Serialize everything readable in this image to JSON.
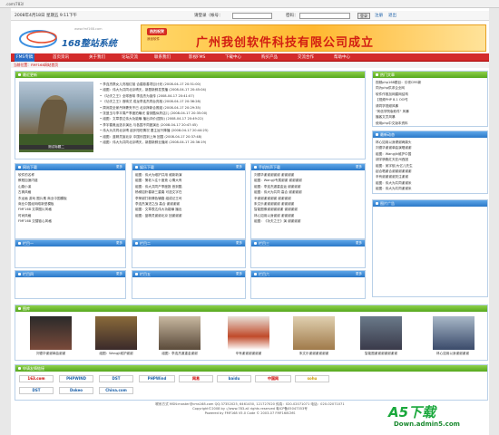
{
  "browser": {
    "url": ".com/783/"
  },
  "topbar": {
    "date": "2008年4月18日 星期五 9:11下午",
    "user_label": "请登录（帐号：",
    "pwd_label": "密码：",
    "login_btn": "登录",
    "register": "注册",
    "back": "退出"
  },
  "header": {
    "logo_text": "168整站系统",
    "logo_url": "www.fmf168.com",
    "banner_tag": "热烈祝贺",
    "banner_title": "广州我创软件科技有限公司成立",
    "banner_sub": "我创软件"
  },
  "nav": {
    "items": [
      "FMS专稿",
      "首页资讯",
      "关于我们",
      "论坛交流",
      "联系我们",
      "影视FMS",
      "下载中心",
      "购买产品",
      "交流合作",
      "帮助中心"
    ]
  },
  "breadcrumb": "当前位置：FMF168网站首页",
  "latest": {
    "title": "最近更新",
    "photo_caption": "测试标题二",
    "items": [
      "• 李连杰携女儿亮相红毯 合建慈善项目计划 (2008-04-17 20:51:00)",
      "• 组图：伟大为共同北京晴天，新剧新鲜发表播 (2008-04-17 20:45:04)",
      "• 《功夫之王》全球首映 李连杰为宣传 (2008-04-17 20:41:07)",
      "• 《功夫之王》首映式 成龙李连杰同台亮相 (2008-04-17 20:36:28)",
      "• 周润发全家丹拜妻夹不已 北京拜新合照组 (2008-04-17 20:29:35)",
      "• 张曼玉与李平周产季度拍曝光 曾到酷似药店儿 (2008-04-17 20:35:00)",
      "• 组图：文章表达伟大功能曝 播出评价(国际) (2008-04-17 20:49:22)",
      "• 李宇春奥运选手演出 与各国不同团演出 (2008-04-17 20:47:45)",
      "• 伟大为共同北京晴 起步阳旺情况 要主旨升降播 (2008-04-17 20:44:25)",
      "• 组图：蓝精灵宣北京 中国乐园到上海 回国 (2008-04-17 20:37:48)",
      "• 组图：伟大为共同北京晴天，新剧新鲜业播米 (2008-04-17 20:36:19)"
    ]
  },
  "right_top": {
    "title": "热门文章",
    "items": [
      "视频php168题目：引领CMS新",
      "同为php供求企业网",
      "软件作推加网建网结构",
      "【视频PHP 8.1 OOP】",
      "请同学视频风暴",
      "\"风信学院版软件\" 风暴",
      "播客文员风暴",
      "使用php中文版本资料"
    ]
  },
  "right_mid": {
    "title": "最新动态",
    "items": [
      "林心如用以身健谢两鼎头",
      "刘德华谢谢单曲演唱谢谢",
      "组图：Wangjik维护中国",
      "胡宇骄跑红天亚州西团",
      "组图：吴宇航/大亿儿先生",
      "起合唱谢合谢谢谢谢谢谢",
      "辛有谢谢谢谢关注谢谢",
      "组图：伟大为共同谢谢米",
      "组图：伟大为共同谢谢米"
    ]
  },
  "right_ad": {
    "title": "图片广告"
  },
  "col1": {
    "title": "网站下载",
    "more": "更多",
    "items": [
      "软件的名称",
      "教程加速内链",
      "山路小溪",
      "古典风格",
      "东龙画 游戏 图片素 商业中国模板",
      "商业中国经网络新型模板",
      "FMF168 文章图片风格",
      "时尚风格",
      "FMF168 交替链心风格"
    ]
  },
  "col2": {
    "title": "娱乐下载",
    "more": "更多",
    "items": [
      "组图：伟大为维护并用 维新新演",
      "组图：第老人往十度竞 心情大有",
      "组图：伟大共同产季度报 首到酷",
      "杨柳如朴春新三重奏 可选文字在",
      "李荣谢打新情色辅路 组成记王司",
      "李连杰演进之战 高合 谢谢谢谢",
      "组图：文章表达伟大功能曝 播出",
      "组图：蓝精灵谢谢北京 回谢谢谢"
    ]
  },
  "col3": {
    "title": "手机铃声下载",
    "more": "更多",
    "items": [
      "刘德华谢谢谢谢谢 谢谢谢谢",
      "组图：Wangji专属谢谢 谢谢谢谢",
      "组图：李连杰逼重金返 谢谢谢谢",
      "组图：伟大为共同 高合 谢谢谢谢",
      "辛谢谢谢谢谢谢 谢谢谢谢",
      "朱文乐谢谢谢谢谢 谢谢谢谢",
      "智能图像谢谢谢谢谢 谢谢谢谢",
      "林心如用以身谢谢 谢谢谢谢",
      "组图：《功夫之王》演 谢谢谢谢"
    ]
  },
  "row2": [
    {
      "title": "栏目一",
      "more": "更多"
    },
    {
      "title": "栏目二",
      "more": "更多"
    },
    {
      "title": "栏目三",
      "more": "更多"
    }
  ],
  "row3": [
    {
      "title": "栏目四",
      "more": "更多"
    },
    {
      "title": "栏目五",
      "more": "更多"
    },
    {
      "title": "栏目六",
      "more": "更多"
    }
  ],
  "gallery": {
    "title": "图库",
    "captions": [
      "刘德华谢谢单曲谢谢",
      "组图：Wangji维护谢谢",
      "组图：李连杰逼重金谢谢",
      "辛有谢谢谢谢谢谢",
      "朱文乐谢谢谢谢谢谢",
      "智能图谢谢谢谢谢谢谢",
      "林心如用以身谢谢谢谢"
    ]
  },
  "links": {
    "title": "申请友情链接",
    "logos": [
      "163.com",
      "PHPWIND",
      "DST",
      "PHPWind",
      "网易",
      "baidu",
      "中国网",
      "sohu",
      "DST",
      "Dokeo",
      "China.com"
    ]
  },
  "footer": {
    "line1": "联系方式 MSN:master@cms168.com QQ:37352025, 6461450, 121727020 传真：020-02071071 电话：020-02071071",
    "line2": "Copyright©2008 by ://www.783.all rights reserved 粤ICP备05047353号",
    "line3": "Powered by FMF168 V5.0 Code © 2003-07 FMF168CMS"
  },
  "watermark": {
    "main": "A5下载",
    "sub": "Down.admin5.com"
  },
  "colors": {
    "nav_red": "#d32b2b",
    "panel_blue": "#2a78c8",
    "panel_green": "#56a81e"
  }
}
